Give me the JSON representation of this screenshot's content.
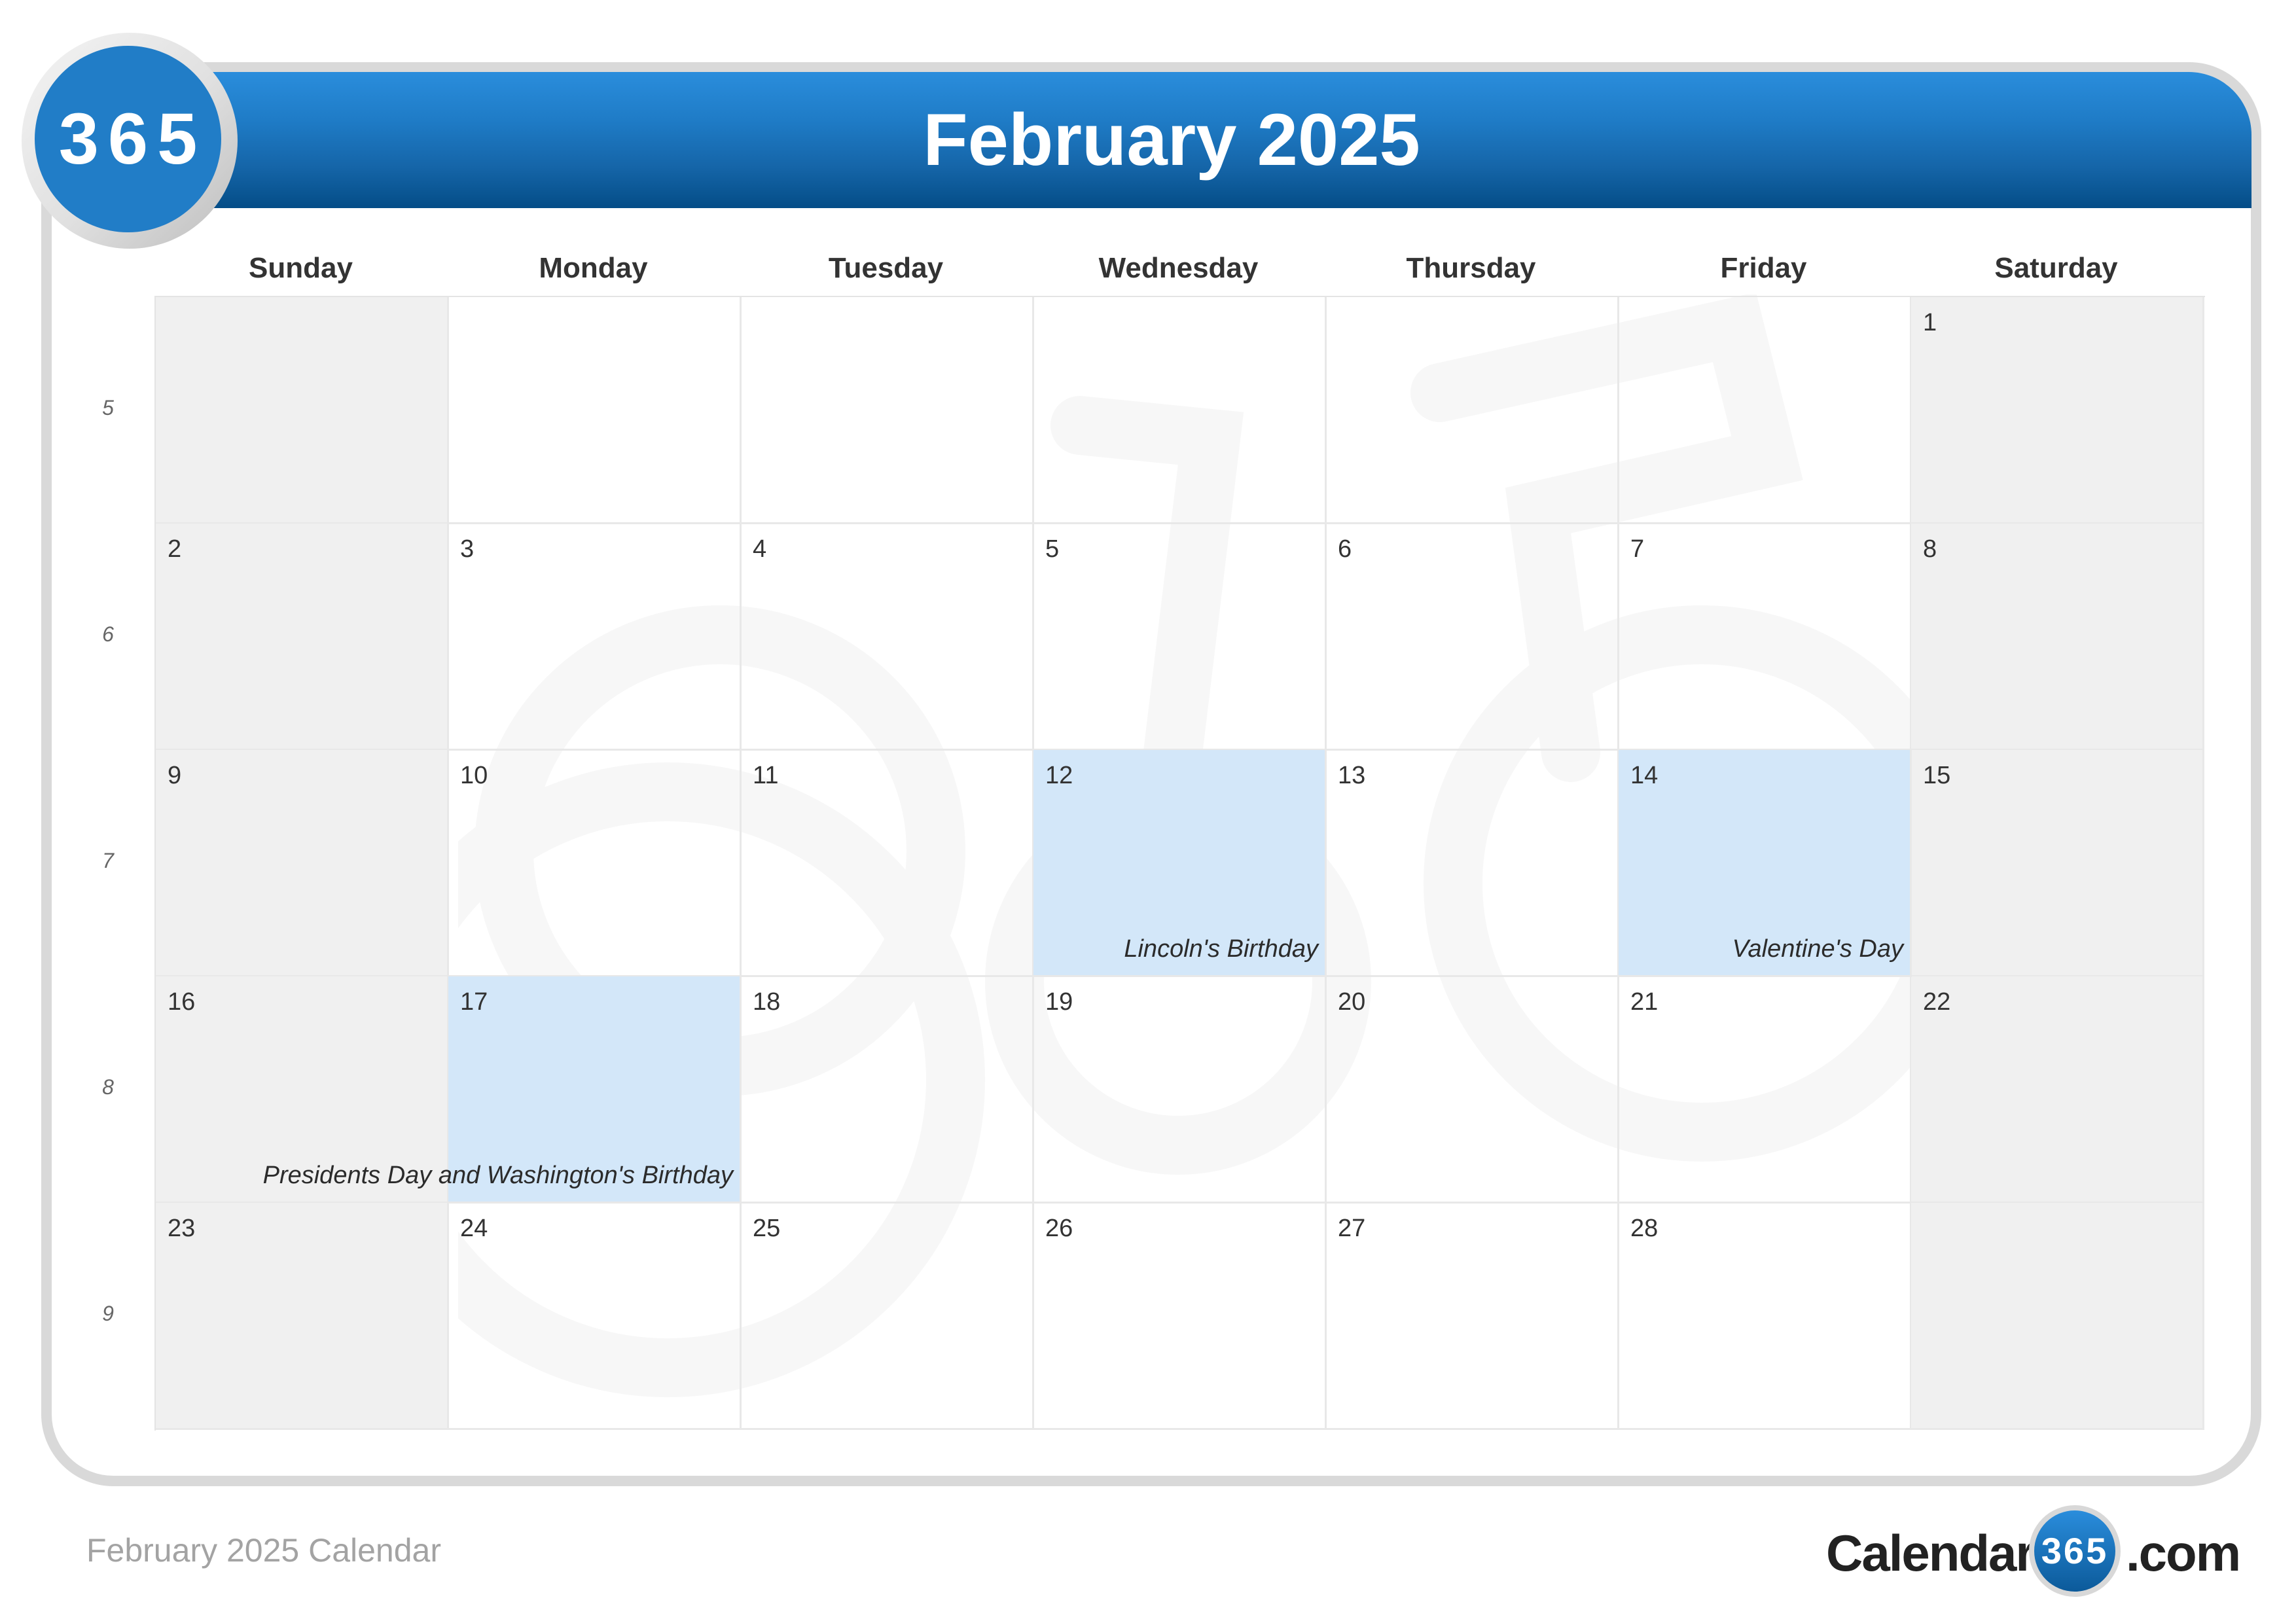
{
  "header": {
    "title": "February 2025",
    "logo_text": "365"
  },
  "days_of_week": [
    "Sunday",
    "Monday",
    "Tuesday",
    "Wednesday",
    "Thursday",
    "Friday",
    "Saturday"
  ],
  "week_numbers": [
    "5",
    "6",
    "7",
    "8",
    "9"
  ],
  "weeks": [
    [
      {
        "day": "",
        "weekend": true
      },
      {
        "day": ""
      },
      {
        "day": ""
      },
      {
        "day": ""
      },
      {
        "day": ""
      },
      {
        "day": ""
      },
      {
        "day": "1",
        "weekend": true
      }
    ],
    [
      {
        "day": "2",
        "weekend": true
      },
      {
        "day": "3"
      },
      {
        "day": "4"
      },
      {
        "day": "5"
      },
      {
        "day": "6"
      },
      {
        "day": "7"
      },
      {
        "day": "8",
        "weekend": true
      }
    ],
    [
      {
        "day": "9",
        "weekend": true
      },
      {
        "day": "10"
      },
      {
        "day": "11"
      },
      {
        "day": "12",
        "holiday": "Lincoln's Birthday"
      },
      {
        "day": "13"
      },
      {
        "day": "14",
        "holiday": "Valentine's Day"
      },
      {
        "day": "15",
        "weekend": true
      }
    ],
    [
      {
        "day": "16",
        "weekend": true
      },
      {
        "day": "17",
        "holiday": "Presidents Day and Washington's Birthday"
      },
      {
        "day": "18"
      },
      {
        "day": "19"
      },
      {
        "day": "20"
      },
      {
        "day": "21"
      },
      {
        "day": "22",
        "weekend": true
      }
    ],
    [
      {
        "day": "23",
        "weekend": true
      },
      {
        "day": "24"
      },
      {
        "day": "25"
      },
      {
        "day": "26"
      },
      {
        "day": "27"
      },
      {
        "day": "28"
      },
      {
        "day": "",
        "weekend": true
      }
    ]
  ],
  "colors": {
    "header_blue": "#1f7cc7",
    "holiday_bg": "#d3e7f9",
    "weekend_bg": "#f0f0f0"
  },
  "footer": {
    "caption": "February 2025 Calendar",
    "brand_left": "Calendar-",
    "brand_badge": "365",
    "brand_right": ".com"
  }
}
